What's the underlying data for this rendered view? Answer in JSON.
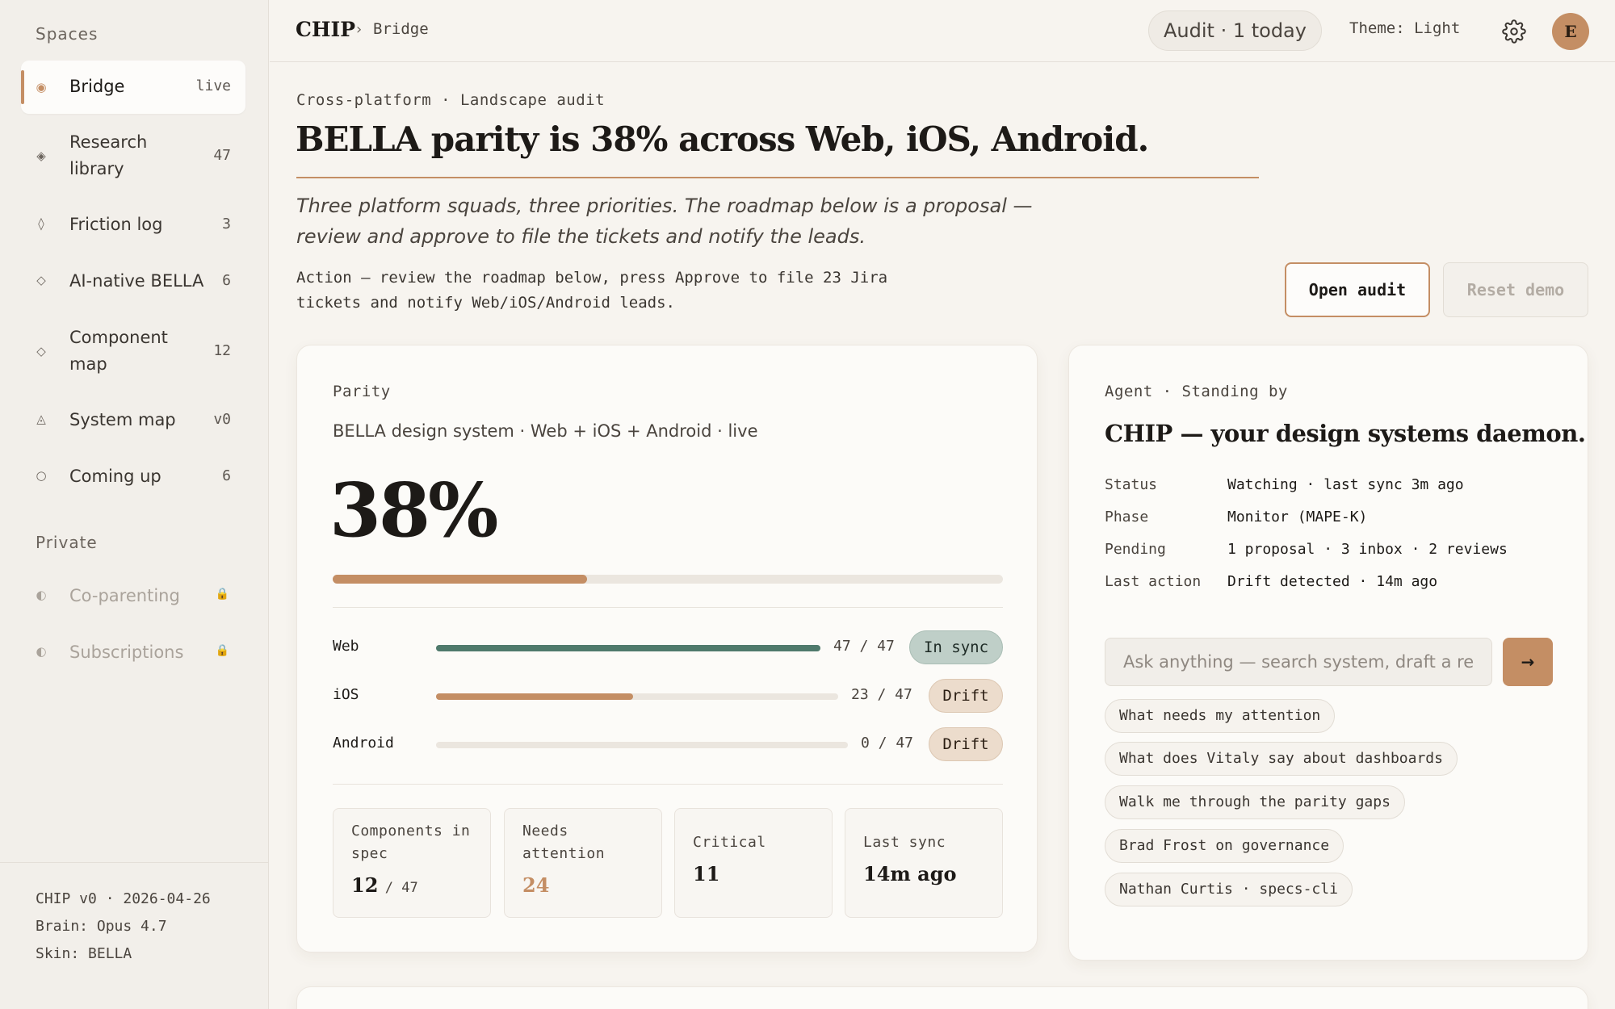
{
  "sidebar": {
    "spaces_heading": "Spaces",
    "items": [
      {
        "icon": "dot-icon",
        "glyph": "◉",
        "label": "Bridge",
        "count": "live"
      },
      {
        "icon": "diamond-filled-icon",
        "glyph": "◈",
        "label": "Research library",
        "count": "47"
      },
      {
        "icon": "diamond-outline-icon",
        "glyph": "◊",
        "label": "Friction log",
        "count": "3"
      },
      {
        "icon": "diamond-small-icon",
        "glyph": "◇",
        "label": "AI-native BELLA",
        "count": "6"
      },
      {
        "icon": "diamond-small-icon",
        "glyph": "◇",
        "label": "Component map",
        "count": "12"
      },
      {
        "icon": "triangle-icon",
        "glyph": "◬",
        "label": "System map",
        "count": "v0"
      },
      {
        "icon": "circle-icon",
        "glyph": "○",
        "label": "Coming up",
        "count": "6"
      }
    ],
    "private_heading": "Private",
    "private_items": [
      {
        "icon": "half-circle-icon",
        "glyph": "◐",
        "label": "Co-parenting"
      },
      {
        "icon": "half-circle-icon",
        "glyph": "◐",
        "label": "Subscriptions"
      }
    ],
    "lock_glyph": "🔒",
    "footer": {
      "version": "CHIP v0 · 2026-04-26",
      "brain": "Brain: Opus 4.7",
      "skin": "Skin: BELLA"
    }
  },
  "topbar": {
    "brand": "CHIP",
    "separator": "›",
    "crumb": "Bridge",
    "audit": "Audit · 1 today",
    "theme": "Theme: Light",
    "avatar_initial": "E"
  },
  "header": {
    "eyebrow": "Cross-platform · Landscape audit",
    "headline": "BELLA parity is 38% across Web, iOS, Android.",
    "subtitle": "Three platform squads, three priorities. The roadmap below is a proposal — review and approve to file the tickets and notify the leads.",
    "action": "Action — review the roadmap below, press Approve to file 23 Jira tickets and notify Web/iOS/Android leads.",
    "open_audit": "Open audit",
    "reset_demo": "Reset demo"
  },
  "parity": {
    "eyebrow": "Parity",
    "system": "BELLA design system · Web + iOS + Android · live",
    "percent_label": "38%",
    "percent": 0.38,
    "platforms": [
      {
        "name": "Web",
        "count": "47 / 47",
        "fraction": 1.0,
        "status": "In sync",
        "kind": "sync"
      },
      {
        "name": "iOS",
        "count": "23 / 47",
        "fraction": 0.49,
        "status": "Drift",
        "kind": "drift"
      },
      {
        "name": "Android",
        "count": "0 / 47",
        "fraction": 0.0,
        "status": "Drift",
        "kind": "drift"
      }
    ],
    "stats": [
      {
        "label": "Components in spec",
        "value": "12",
        "of": "/ 47"
      },
      {
        "label": "Needs attention",
        "value": "24"
      },
      {
        "label": "Critical",
        "value": "11"
      },
      {
        "label": "Last sync",
        "value": "14m ago"
      }
    ]
  },
  "agent": {
    "eyebrow": "Agent · Standing by",
    "title": "CHIP — your design systems daemon.",
    "rows": [
      {
        "key": "Status",
        "value": "Watching · last sync 3m ago"
      },
      {
        "key": "Phase",
        "value": "Monitor (MAPE-K)"
      },
      {
        "key": "Pending",
        "value": "1 proposal · 3 inbox · 2 reviews"
      },
      {
        "key": "Last action",
        "value": "Drift detected · 14m ago"
      }
    ],
    "ask_placeholder": "Ask anything — search system, draft a reply",
    "send_glyph": "→",
    "suggestions": [
      "What needs my attention",
      "What does Vitaly say about dashboards",
      "Walk me through the parity gaps",
      "Brad Frost on governance",
      "Nathan Curtis · specs-cli"
    ]
  },
  "colors": {
    "accent": "#c48e64",
    "in_sync": "#4f7a6c",
    "background": "#f7f4ef"
  }
}
